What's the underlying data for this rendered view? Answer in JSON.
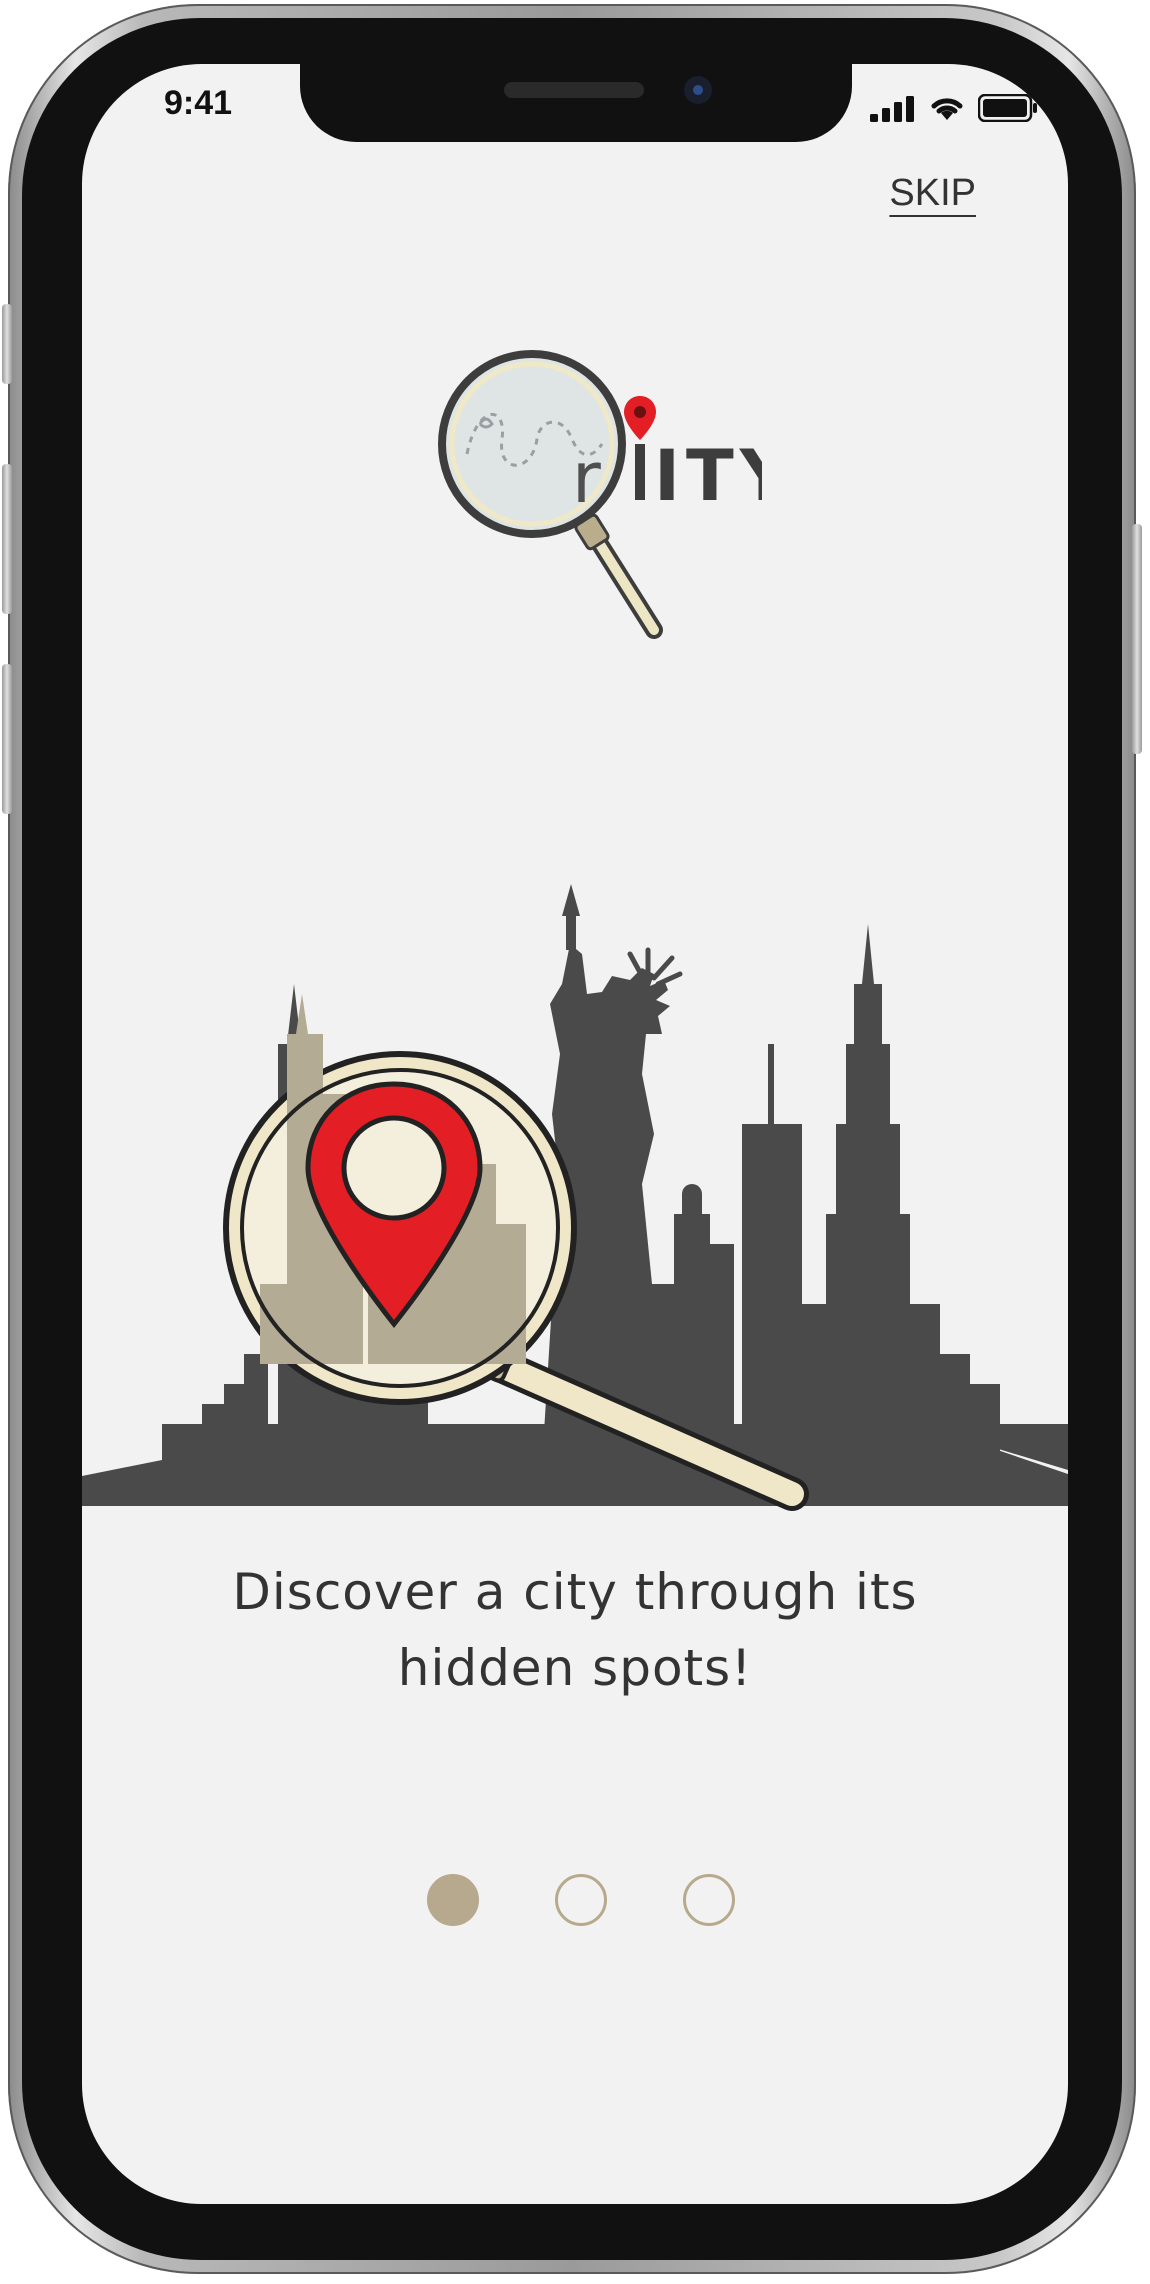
{
  "status_bar": {
    "time": "9:41",
    "icons": [
      "cellular-signal-icon",
      "wifi-icon",
      "battery-icon"
    ]
  },
  "header": {
    "skip_label": "SKIP"
  },
  "logo": {
    "text": "ITY",
    "accent_color": "#e31e24"
  },
  "onboarding": {
    "tagline_line1": "Discover a city through its",
    "tagline_line2": "hidden spots!",
    "page_indicator": {
      "total": 3,
      "active_index": 0
    }
  },
  "colors": {
    "background": "#f1f2f1",
    "skyline": "#4b4a4a",
    "pin": "#e31e24",
    "lens_tint": "#f3efdc",
    "dot_active": "#b7a98e"
  }
}
